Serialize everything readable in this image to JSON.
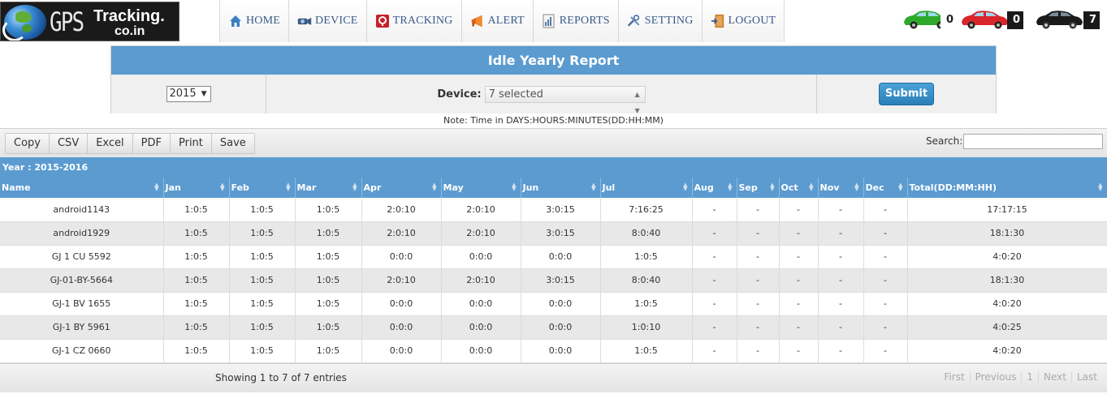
{
  "header": {
    "logo_gps": "GPS",
    "logo_tracking": "Tracking.",
    "logo_domain": "co.in",
    "nav": [
      {
        "label": "HOME",
        "icon": "home-icon"
      },
      {
        "label": "DEVICE",
        "icon": "device-icon"
      },
      {
        "label": "TRACKING",
        "icon": "tracking-icon"
      },
      {
        "label": "ALERT",
        "icon": "alert-icon"
      },
      {
        "label": "REPORTS",
        "icon": "reports-icon"
      },
      {
        "label": "SETTING",
        "icon": "setting-icon"
      },
      {
        "label": "LOGOUT",
        "icon": "logout-icon"
      }
    ],
    "vehicle_counts": [
      {
        "status": "running",
        "color": "#2eaa2a",
        "count": "0"
      },
      {
        "status": "stopped",
        "color": "#d9252b",
        "count": "0"
      },
      {
        "status": "inactive",
        "color": "#1a1a1a",
        "count": "7"
      }
    ]
  },
  "report": {
    "title": "Idle Yearly Report",
    "year": "2015",
    "device_label": "Device:",
    "device_value": "7 selected",
    "submit_label": "Submit",
    "note": "Note: Time in DAYS:HOURS:MINUTES(DD:HH:MM)"
  },
  "toolbar": {
    "buttons": [
      "Copy",
      "CSV",
      "Excel",
      "PDF",
      "Print",
      "Save"
    ],
    "search_label": "Search:"
  },
  "table": {
    "year_label": "Year : 2015-2016",
    "columns": [
      "Name",
      "Jan",
      "Feb",
      "Mar",
      "Apr",
      "May",
      "Jun",
      "Jul",
      "Aug",
      "Sep",
      "Oct",
      "Nov",
      "Dec",
      "Total(DD:MM:HH)"
    ],
    "rows": [
      [
        "android1143",
        "1:0:5",
        "1:0:5",
        "1:0:5",
        "2:0:10",
        "2:0:10",
        "3:0:15",
        "7:16:25",
        "-",
        "-",
        "-",
        "-",
        "-",
        "17:17:15"
      ],
      [
        "android1929",
        "1:0:5",
        "1:0:5",
        "1:0:5",
        "2:0:10",
        "2:0:10",
        "3:0:15",
        "8:0:40",
        "-",
        "-",
        "-",
        "-",
        "-",
        "18:1:30"
      ],
      [
        "GJ 1 CU 5592",
        "1:0:5",
        "1:0:5",
        "1:0:5",
        "0:0:0",
        "0:0:0",
        "0:0:0",
        "1:0:5",
        "-",
        "-",
        "-",
        "-",
        "-",
        "4:0:20"
      ],
      [
        "GJ-01-BY-5664",
        "1:0:5",
        "1:0:5",
        "1:0:5",
        "2:0:10",
        "2:0:10",
        "3:0:15",
        "8:0:40",
        "-",
        "-",
        "-",
        "-",
        "-",
        "18:1:30"
      ],
      [
        "GJ-1 BV 1655",
        "1:0:5",
        "1:0:5",
        "1:0:5",
        "0:0:0",
        "0:0:0",
        "0:0:0",
        "1:0:5",
        "-",
        "-",
        "-",
        "-",
        "-",
        "4:0:20"
      ],
      [
        "GJ-1 BY 5961",
        "1:0:5",
        "1:0:5",
        "1:0:5",
        "0:0:0",
        "0:0:0",
        "0:0:0",
        "1:0:10",
        "-",
        "-",
        "-",
        "-",
        "-",
        "4:0:25"
      ],
      [
        "GJ-1 CZ 0660",
        "1:0:5",
        "1:0:5",
        "1:0:5",
        "0:0:0",
        "0:0:0",
        "0:0:0",
        "1:0:5",
        "-",
        "-",
        "-",
        "-",
        "-",
        "4:0:20"
      ]
    ]
  },
  "footer": {
    "info": "Showing 1 to 7 of 7 entries",
    "pager": [
      "First",
      "Previous",
      "1",
      "Next",
      "Last"
    ]
  },
  "colors": {
    "accent": "#5b9bd0",
    "button": "#2a7fb7",
    "row_alt": "#e8e8e8"
  }
}
